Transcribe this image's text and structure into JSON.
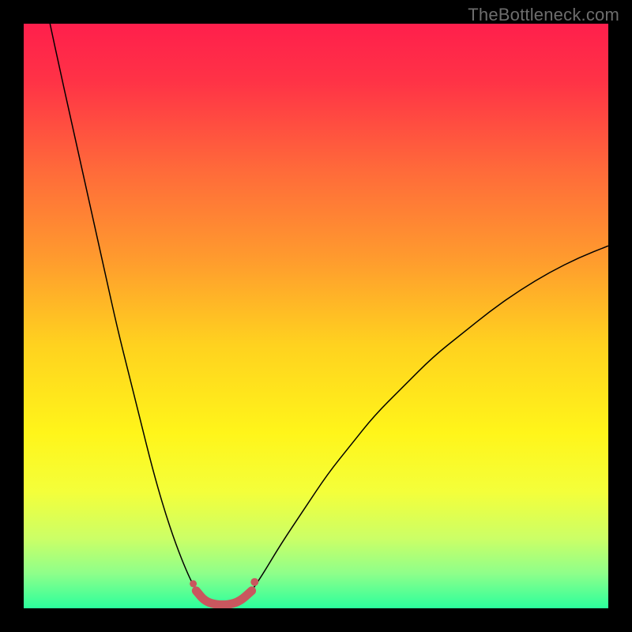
{
  "watermark": "TheBottleneck.com",
  "chart_data": {
    "type": "line",
    "title": "",
    "xlabel": "",
    "ylabel": "",
    "xlim": [
      0,
      100
    ],
    "ylim": [
      0,
      100
    ],
    "grid": false,
    "background_gradient": {
      "stops": [
        {
          "pos": 0.0,
          "color": "#ff1f4c"
        },
        {
          "pos": 0.1,
          "color": "#ff3346"
        },
        {
          "pos": 0.25,
          "color": "#ff6a3a"
        },
        {
          "pos": 0.4,
          "color": "#ff9a2e"
        },
        {
          "pos": 0.55,
          "color": "#ffd21f"
        },
        {
          "pos": 0.7,
          "color": "#fff51a"
        },
        {
          "pos": 0.8,
          "color": "#f4ff3a"
        },
        {
          "pos": 0.88,
          "color": "#ccff66"
        },
        {
          "pos": 0.94,
          "color": "#8fff8a"
        },
        {
          "pos": 1.0,
          "color": "#2bff9c"
        }
      ]
    },
    "series": [
      {
        "name": "left-arm",
        "stroke": "#000000",
        "stroke_width": 1.5,
        "x": [
          4.5,
          6,
          8,
          10,
          12,
          14,
          16,
          18,
          20,
          22,
          24,
          26,
          28,
          29.5
        ],
        "y": [
          100,
          93,
          84,
          75,
          66,
          57,
          48,
          40,
          32,
          24,
          17,
          11,
          6,
          3
        ]
      },
      {
        "name": "right-arm",
        "stroke": "#000000",
        "stroke_width": 1.5,
        "x": [
          39,
          41,
          44,
          48,
          52,
          56,
          60,
          65,
          70,
          75,
          80,
          85,
          90,
          95,
          100
        ],
        "y": [
          3,
          6,
          11,
          17,
          23,
          28,
          33,
          38,
          43,
          47,
          51,
          54.5,
          57.5,
          60,
          62
        ]
      },
      {
        "name": "valley-band",
        "stroke": "#c9575e",
        "stroke_width": 11,
        "linecap": "round",
        "x": [
          29.5,
          31,
          33,
          35,
          37,
          39
        ],
        "y": [
          3,
          1.2,
          0.6,
          0.6,
          1.2,
          3
        ]
      }
    ],
    "markers": [
      {
        "name": "valley-dot-left",
        "x": 29.0,
        "y": 4.2,
        "r": 4.5,
        "color": "#c9575e"
      },
      {
        "name": "valley-dot-right",
        "x": 39.5,
        "y": 4.5,
        "r": 5.0,
        "color": "#c9575e"
      }
    ]
  }
}
